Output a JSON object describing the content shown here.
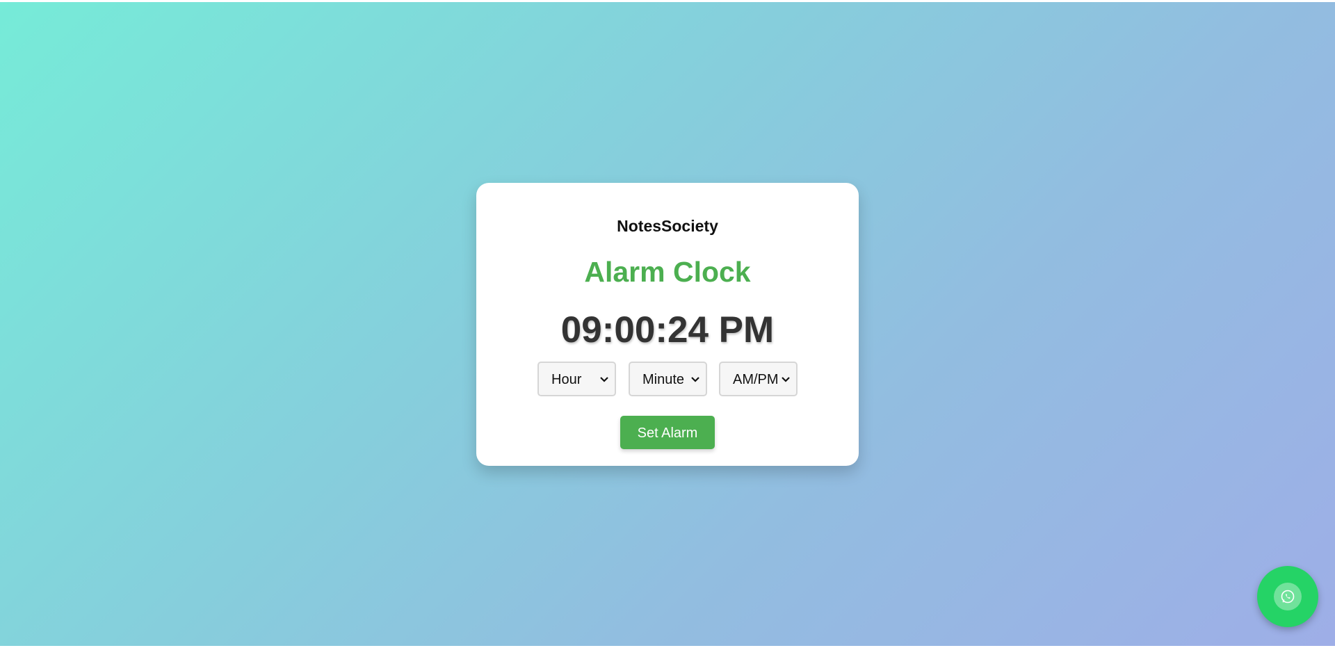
{
  "brand": "NotesSociety",
  "title": "Alarm Clock",
  "current_time": "09:00:24 PM",
  "selects": {
    "hour": "Hour",
    "minute": "Minute",
    "ampm": "AM/PM"
  },
  "set_alarm_label": "Set Alarm",
  "colors": {
    "accent": "#4caf50",
    "whatsapp": "#25d366",
    "time_text": "#333333"
  },
  "icons": {
    "select_arrow": "chevron-down-icon",
    "floating_button": "whatsapp-icon"
  }
}
